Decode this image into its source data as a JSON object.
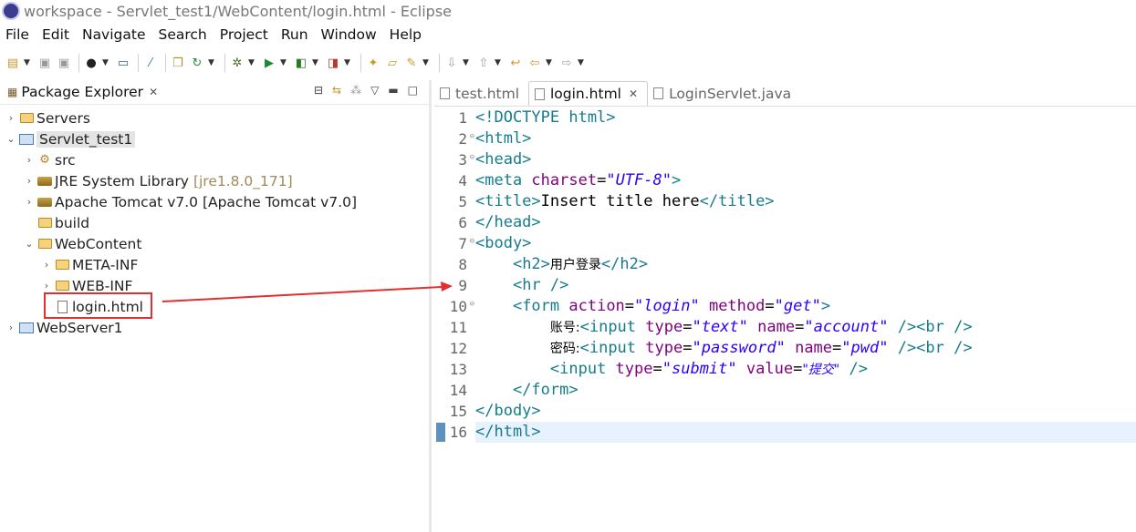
{
  "window": {
    "title": "workspace - Servlet_test1/WebContent/login.html - Eclipse"
  },
  "menu": [
    "File",
    "Edit",
    "Navigate",
    "Search",
    "Project",
    "Run",
    "Window",
    "Help"
  ],
  "package_explorer": {
    "title": "Package Explorer",
    "items": {
      "servers": {
        "label": "Servers"
      },
      "servlet_test1": {
        "label": "Servlet_test1"
      },
      "src": {
        "label": "src"
      },
      "jre": {
        "label": "JRE System Library",
        "decoration": "[jre1.8.0_171]"
      },
      "tomcat": {
        "label": "Apache Tomcat v7.0 [Apache Tomcat v7.0]"
      },
      "build": {
        "label": "build"
      },
      "webcontent": {
        "label": "WebContent"
      },
      "meta_inf": {
        "label": "META-INF"
      },
      "web_inf": {
        "label": "WEB-INF"
      },
      "login_html": {
        "label": "login.html"
      },
      "webserver1": {
        "label": "WebServer1"
      }
    }
  },
  "editor": {
    "tabs": {
      "test": {
        "label": "test.html"
      },
      "login": {
        "label": "login.html"
      },
      "loginservlet": {
        "label": "LoginServlet.java"
      }
    },
    "line_numbers": [
      "1",
      "2",
      "3",
      "4",
      "5",
      "6",
      "7",
      "8",
      "9",
      "10",
      "11",
      "12",
      "13",
      "14",
      "15",
      "16"
    ],
    "code": {
      "l1_tag": "<!DOCTYPE html>",
      "l2_tag": "<html>",
      "l3_tag": "<head>",
      "l4_open": "<meta ",
      "l4_attr": "charset",
      "l4_eq": "=",
      "l4_val": "\"UTF-8\"",
      "l4_close": ">",
      "l5_open": "<title>",
      "l5_text": "Insert title here",
      "l5_close": "</title>",
      "l6_tag": "</head>",
      "l7_tag": "<body>",
      "l8_open": "<h2>",
      "l8_text": "用户登录",
      "l8_close": "</h2>",
      "l9_tag": "<hr />",
      "l10_open": "<form ",
      "l10_attr1": "action",
      "l10_val1": "\"login\"",
      "l10_attr2": "method",
      "l10_val2": "\"get\"",
      "l10_close": ">",
      "l11_text": "账号:",
      "l11_open": "<input ",
      "l11_attr1": "type",
      "l11_val1": "\"text\"",
      "l11_attr2": "name",
      "l11_val2": "\"account\"",
      "l11_close": " /><br />",
      "l12_text": "密码:",
      "l12_open": "<input ",
      "l12_attr1": "type",
      "l12_val1": "\"password\"",
      "l12_attr2": "name",
      "l12_val2": "\"pwd\"",
      "l12_close": " /><br />",
      "l13_open": "<input ",
      "l13_attr1": "type",
      "l13_val1": "\"submit\"",
      "l13_attr2": "value",
      "l13_val2": "\"提交\"",
      "l13_close": " />",
      "l14_tag": "</form>",
      "l15_tag": "</body>",
      "l16_tag": "</html>"
    }
  },
  "colors": {
    "tag": "#167c8c",
    "attribute": "#7f007f",
    "value": "#2a00ff",
    "annotation_red": "#e03030",
    "current_line": "#e8f2fe"
  }
}
